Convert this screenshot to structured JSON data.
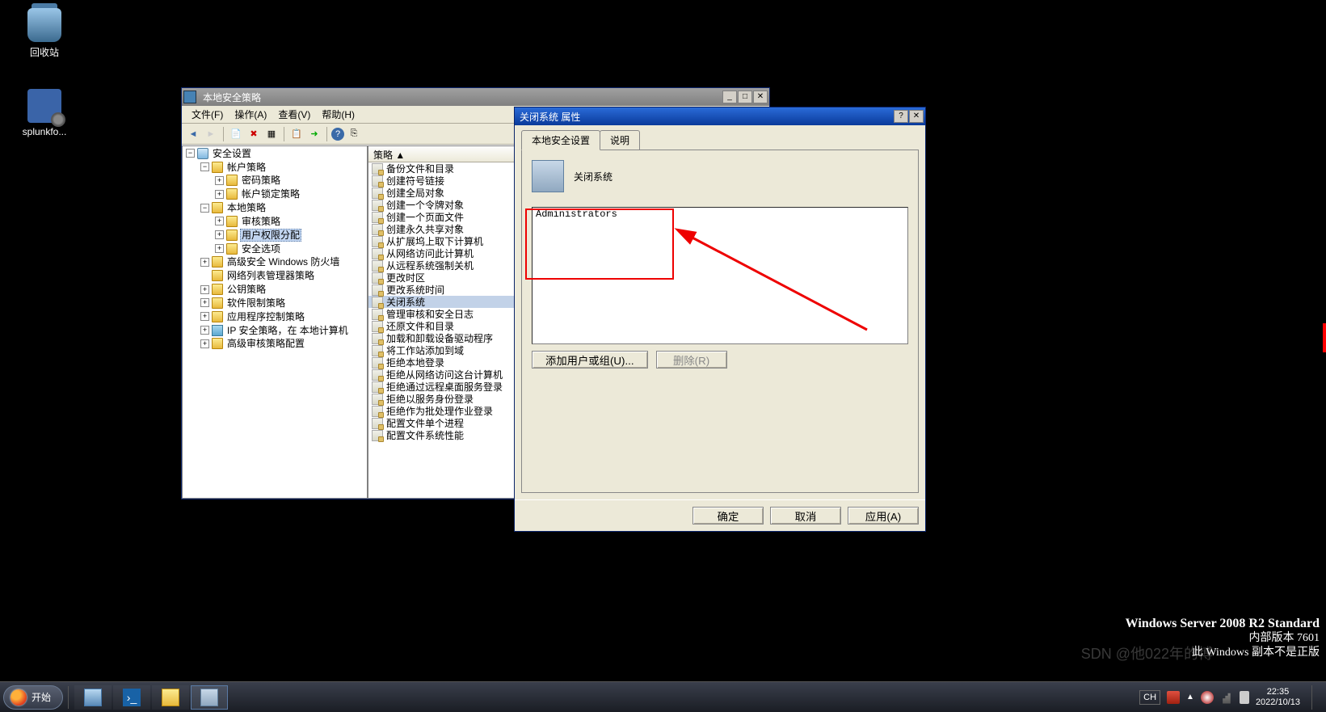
{
  "desktop": {
    "recycle_bin": "回收站",
    "splunk": "splunkfo..."
  },
  "secpol": {
    "title": "本地安全策略",
    "menus": {
      "file": "文件(F)",
      "action": "操作(A)",
      "view": "查看(V)",
      "help": "帮助(H)"
    },
    "tree": {
      "root": "安全设置",
      "account_policy": "帐户策略",
      "password_policy": "密码策略",
      "lockout_policy": "帐户锁定策略",
      "local_policy": "本地策略",
      "audit_policy": "审核策略",
      "user_rights": "用户权限分配",
      "security_options": "安全选项",
      "firewall": "高级安全 Windows 防火墙",
      "netlist": "网络列表管理器策略",
      "pubkey": "公钥策略",
      "software_restrict": "软件限制策略",
      "appctrl": "应用程序控制策略",
      "ipsec": "IP 安全策略，在 本地计算机",
      "adv_audit": "高级审核策略配置"
    },
    "list_header": "策略 ▲",
    "policies": [
      "备份文件和目录",
      "创建符号链接",
      "创建全局对象",
      "创建一个令牌对象",
      "创建一个页面文件",
      "创建永久共享对象",
      "从扩展坞上取下计算机",
      "从网络访问此计算机",
      "从远程系统强制关机",
      "更改时区",
      "更改系统时间",
      "关闭系统",
      "管理审核和安全日志",
      "还原文件和目录",
      "加载和卸载设备驱动程序",
      "将工作站添加到域",
      "拒绝本地登录",
      "拒绝从网络访问这台计算机",
      "拒绝通过远程桌面服务登录",
      "拒绝以服务身份登录",
      "拒绝作为批处理作业登录",
      "配置文件单个进程",
      "配置文件系统性能"
    ],
    "selected_policy_index": 11
  },
  "props": {
    "title": "关闭系统 属性",
    "tab_local": "本地安全设置",
    "tab_explain": "说明",
    "heading": "关闭系统",
    "members": [
      "Administrators"
    ],
    "btn_add": "添加用户或组(U)...",
    "btn_remove": "删除(R)",
    "btn_ok": "确定",
    "btn_cancel": "取消",
    "btn_apply": "应用(A)"
  },
  "osinfo": {
    "line1": "Windows Server 2008 R2 Standard",
    "line2": "内部版本 7601",
    "line3": "此 Windows 副本不是正版"
  },
  "watermark": "SDN @他022年的博",
  "taskbar": {
    "start": "开始",
    "lang": "CH",
    "time": "22:35",
    "date": "2022/10/13"
  }
}
